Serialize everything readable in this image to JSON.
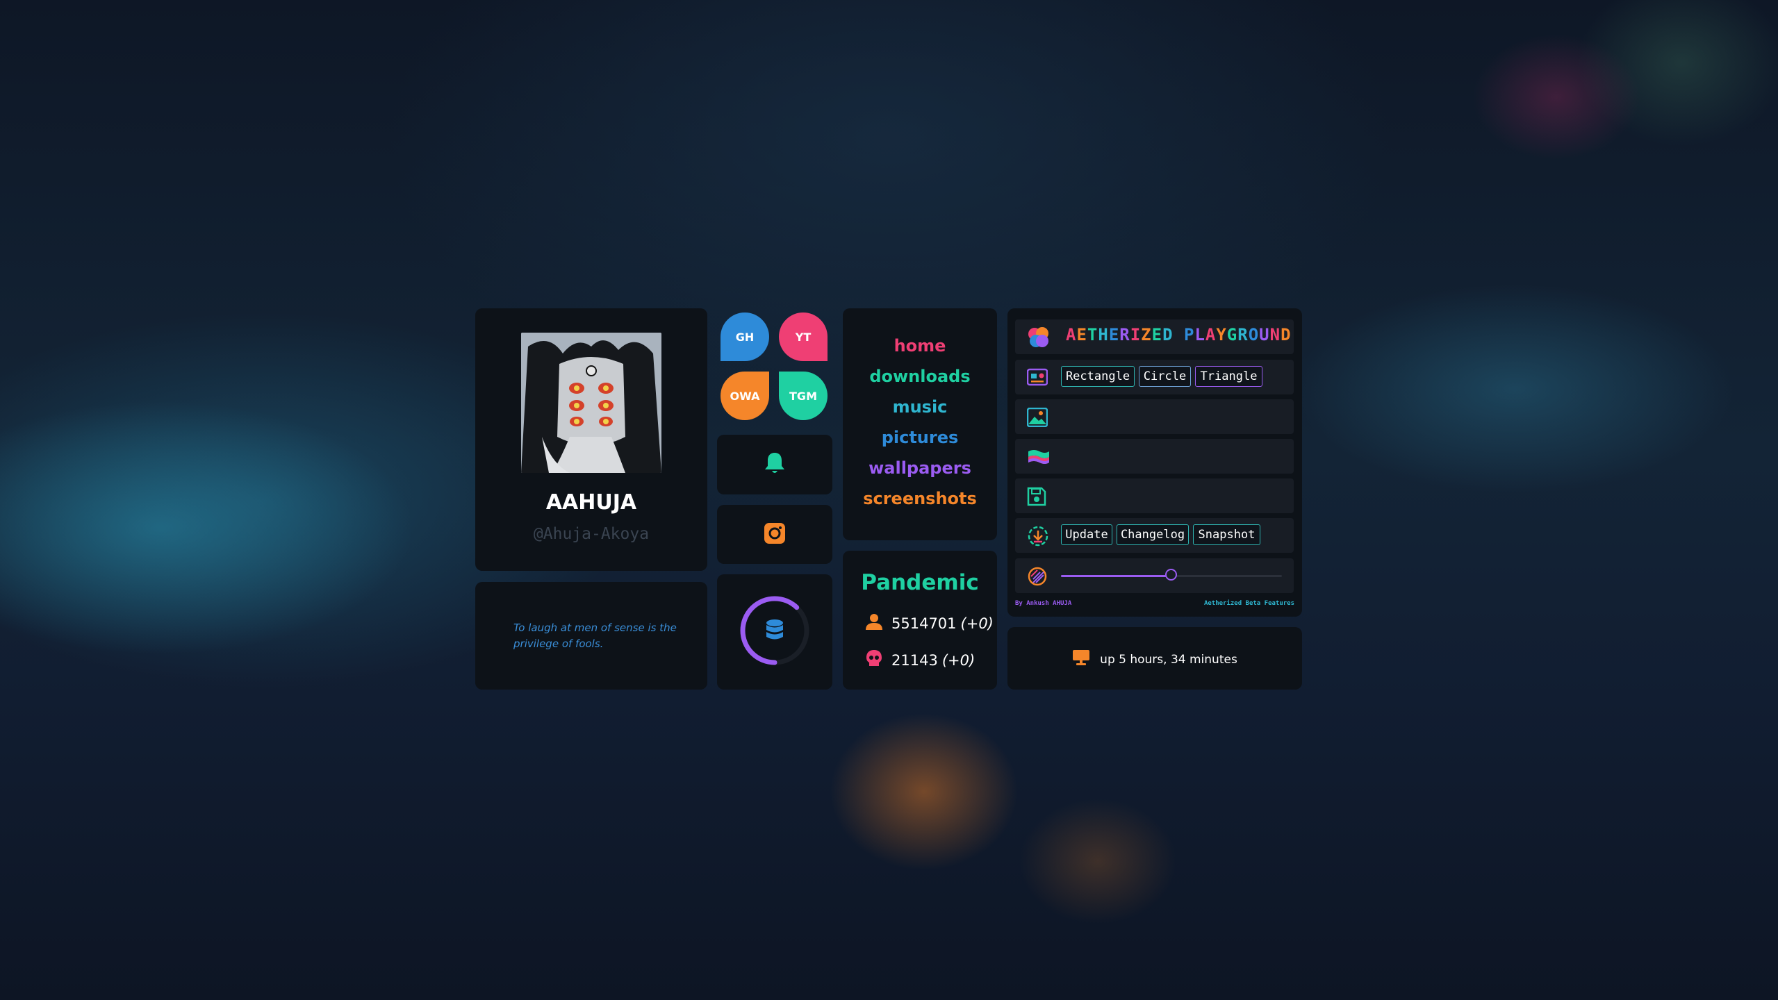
{
  "profile": {
    "name": "AAHUJA",
    "handle": "@Ahuja-Akoya"
  },
  "quote": "To laugh at men of sense is the privilege of fools.",
  "bubbles": [
    {
      "label": "GH",
      "color": "#2e8bd9"
    },
    {
      "label": "YT",
      "color": "#ef3f74"
    },
    {
      "label": "OWA",
      "color": "#f5862a"
    },
    {
      "label": "TGM",
      "color": "#1fd0a2"
    }
  ],
  "icons": {
    "bell": "bell-icon",
    "instagram": "instagram-icon",
    "disk": "database-icon",
    "disk_usage_fraction": 0.62
  },
  "links": [
    {
      "label": "home",
      "color": "#ef3f74"
    },
    {
      "label": "downloads",
      "color": "#1fd0a2"
    },
    {
      "label": "music",
      "color": "#2fb6d0"
    },
    {
      "label": "pictures",
      "color": "#2e8bd9"
    },
    {
      "label": "wallpapers",
      "color": "#9b5cf2"
    },
    {
      "label": "screenshots",
      "color": "#f5862a"
    }
  ],
  "pandemic": {
    "title": "Pandemic",
    "cases": "5514701",
    "cases_delta": "(+0)",
    "deaths": "21143",
    "deaths_delta": "(+0)"
  },
  "playground": {
    "title": "AETHERIZED PLAYGROUND",
    "shape_buttons": [
      "Rectangle",
      "Circle",
      "Triangle"
    ],
    "update_buttons": [
      "Update",
      "Changelog",
      "Snapshot"
    ],
    "slider_value": 0.5,
    "footer_left": "By Ankush AHUJA",
    "footer_right": "Aetherized Beta Features"
  },
  "uptime": "up 5 hours, 34 minutes",
  "colors": {
    "pink": "#ef3f74",
    "teal": "#1fd0a2",
    "cyan": "#2fb6d0",
    "blue": "#2e8bd9",
    "purple": "#9b5cf2",
    "orange": "#f5862a"
  }
}
